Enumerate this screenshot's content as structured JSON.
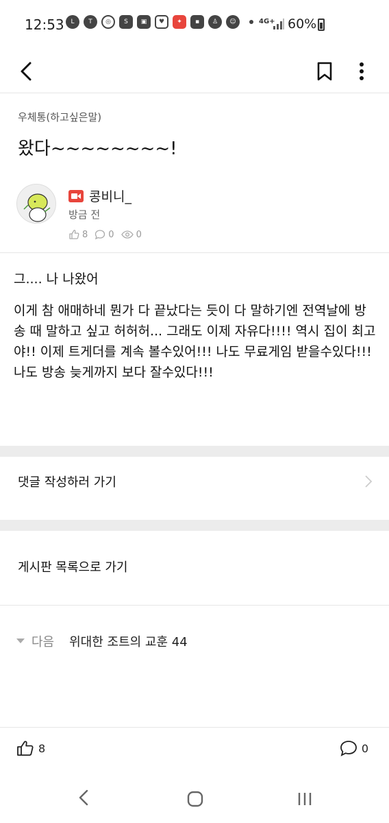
{
  "status_bar": {
    "time": "12:53",
    "network": "4G+",
    "battery": "60%",
    "icons": [
      "line-icon",
      "talk-icon",
      "sync-icon",
      "shopping-icon",
      "gift-icon",
      "heart-icon",
      "game-icon",
      "chat-icon",
      "person-icon",
      "emoji-icon",
      "dot-icon"
    ]
  },
  "app_bar": {
    "icons": [
      "back-icon",
      "bookmark-icon",
      "more-vertical-icon"
    ]
  },
  "post": {
    "category": "우체통(하고싶은말)",
    "title": "왔다~~~~~~~~!",
    "author": "콩비니_",
    "time": "방금 전",
    "likes": "8",
    "comments": "0",
    "views": "0",
    "paragraphs": [
      "그.... 나 나왔어",
      "이게 참 애매하네  뭔가 다 끝났다는 듯이 다 말하기엔 전역날에 방송 때 말하고 싶고 허허허...  그래도 이제 자유다!!!!  역시 집이 최고야!! 이제 트게더를 계속 볼수있어!!! 나도 무료게임 받을수있다!!! 나도 방송 늦게까지 보다 잘수있다!!!"
    ]
  },
  "links": {
    "write_comment": "댓글 작성하러 가기",
    "board_list": "게시판 목록으로 가기"
  },
  "next_post": {
    "label": "다음",
    "title": "위대한 조트의 교훈 44"
  },
  "action_bar": {
    "likes": "8",
    "comments": "0"
  },
  "colors": {
    "accent_red": "#e8453c",
    "divider": "#e6e6e6",
    "band": "#ececec"
  }
}
